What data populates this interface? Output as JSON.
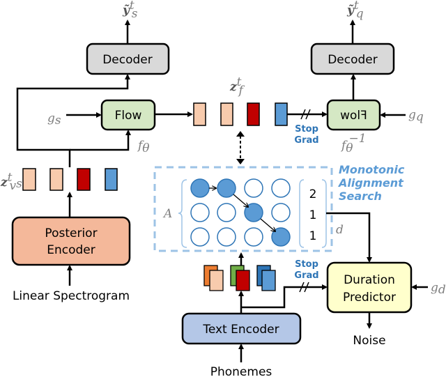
{
  "blocks": {
    "decoder_left": "Decoder",
    "decoder_right": "Decoder",
    "flow": "Flow",
    "flow_inverse": "Flow",
    "posterior_encoder": [
      "Posterior",
      "Encoder"
    ],
    "duration_predictor": [
      "Duration",
      "Predictor"
    ],
    "text_encoder": "Text Encoder"
  },
  "inputs": {
    "linear_spectrogram": "Linear Spectrogram",
    "phonemes": "Phonemes",
    "noise": "Noise"
  },
  "symbols": {
    "y_s": "ỹ",
    "y_s_sup": "t",
    "y_s_sub": "s",
    "y_q": "ỹ",
    "y_q_sup": "t",
    "y_q_sub": "q",
    "g_s": "g",
    "g_s_sub": "s",
    "g_q": "g",
    "g_q_sub": "q",
    "g_d": "g",
    "g_d_sub": "d",
    "f_theta": "f",
    "f_theta_sub": "θ",
    "f_theta_inv_sub": "θ",
    "f_theta_inv_sup": "−1",
    "z_f": "z",
    "z_f_sup": "t",
    "z_f_sub": "f",
    "z_v": "z",
    "z_v_sup": "t",
    "z_v_sub": "v",
    "z_v_subsup": "s",
    "A": "A",
    "d": "d"
  },
  "stop_grad": [
    "Stop",
    "Grad"
  ],
  "mas_label": [
    "Monotonic",
    "Alignment",
    "Search"
  ],
  "durations": [
    "2",
    "1",
    "1"
  ],
  "alignment_matrix": [
    [
      1,
      1,
      0,
      0
    ],
    [
      0,
      0,
      1,
      0
    ],
    [
      0,
      0,
      0,
      1
    ]
  ],
  "colors": {
    "peach": "#f8cbad",
    "red": "#c00000",
    "blue": "#5b9bd5",
    "dark_blue": "#2e75b6",
    "orange": "#ed7d31",
    "green": "#70ad47",
    "flow": "#d5e8c4",
    "decoder": "#d9d9d9",
    "posterior": "#f4b89a",
    "duration": "#ffffcc",
    "text_encoder": "#b4c7e7",
    "mas_border": "#9dc3e6"
  }
}
